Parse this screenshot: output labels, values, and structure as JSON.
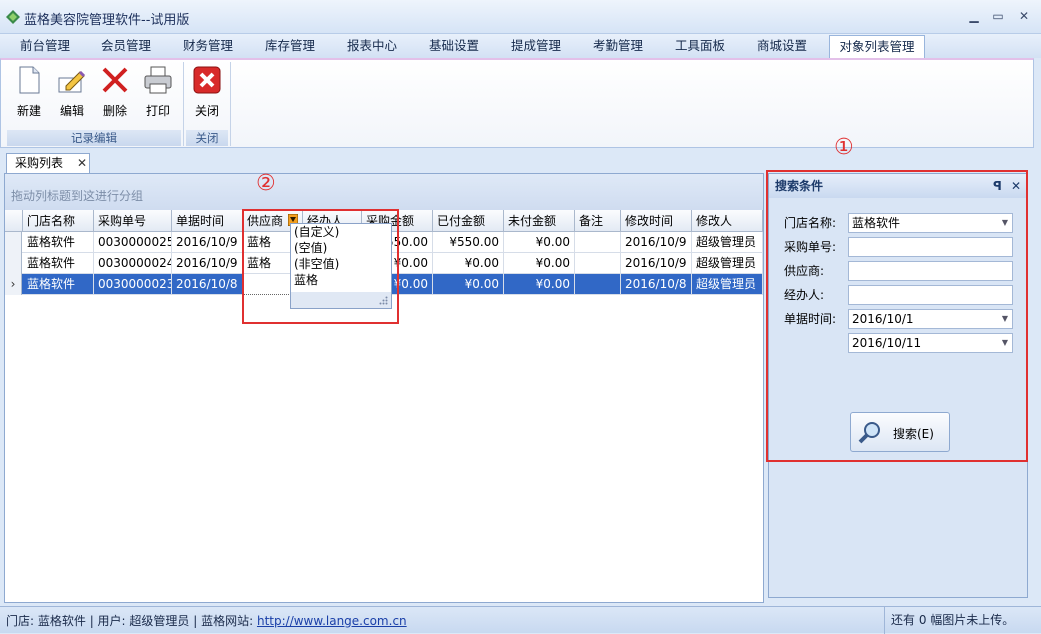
{
  "window": {
    "title": "蓝格美容院管理软件--试用版",
    "minimize": "▁",
    "maximize": "▭",
    "close": "✕"
  },
  "menu_tabs": [
    {
      "label": "前台管理"
    },
    {
      "label": "会员管理"
    },
    {
      "label": "财务管理"
    },
    {
      "label": "库存管理"
    },
    {
      "label": "报表中心"
    },
    {
      "label": "基础设置"
    },
    {
      "label": "提成管理"
    },
    {
      "label": "考勤管理"
    },
    {
      "label": "工具面板"
    },
    {
      "label": "商城设置"
    },
    {
      "label": "对象列表管理"
    }
  ],
  "ribbon": {
    "new": "新建",
    "edit": "编辑",
    "delete": "删除",
    "print": "打印",
    "close": "关闭",
    "group_record": "记录编辑",
    "group_close": "关闭"
  },
  "doc_tab": {
    "label": "采购列表",
    "close": "✕"
  },
  "grid": {
    "group_hint": "拖动列标题到这进行分组",
    "columns": [
      "门店名称",
      "采购单号",
      "单据时间",
      "供应商",
      "经办人",
      "采购金额",
      "已付金额",
      "未付金额",
      "备注",
      "修改时间",
      "修改人"
    ],
    "rows": [
      {
        "indicator": "",
        "store": "蓝格软件",
        "no": "0030000025",
        "date": "2016/10/9",
        "supplier": "蓝格",
        "handler": "",
        "amount": "¥550.00",
        "paid": "¥550.00",
        "unpaid": "¥0.00",
        "note": "",
        "mtime": "2016/10/9",
        "modifier": "超级管理员"
      },
      {
        "indicator": "",
        "store": "蓝格软件",
        "no": "0030000024",
        "date": "2016/10/9",
        "supplier": "蓝格",
        "handler": "",
        "amount": "¥0.00",
        "paid": "¥0.00",
        "unpaid": "¥0.00",
        "note": "",
        "mtime": "2016/10/9",
        "modifier": "超级管理员"
      },
      {
        "indicator": "›",
        "store": "蓝格软件",
        "no": "0030000023",
        "date": "2016/10/8",
        "supplier": "",
        "handler": "",
        "amount": "¥0.00",
        "paid": "¥0.00",
        "unpaid": "¥0.00",
        "note": "",
        "mtime": "2016/10/8",
        "modifier": "超级管理员"
      }
    ]
  },
  "filter_dropdown": {
    "options": [
      "(自定义)",
      "(空值)",
      "(非空值)",
      "蓝格"
    ]
  },
  "annotations": {
    "one": "①",
    "two": "②"
  },
  "search_panel": {
    "title": "搜索条件",
    "pin": "ꟼ",
    "close": "✕",
    "store_label": "门店名称:",
    "store_value": "蓝格软件",
    "no_label": "采购单号:",
    "no_value": "",
    "supplier_label": "供应商:",
    "supplier_value": "",
    "handler_label": "经办人:",
    "handler_value": "",
    "date_label": "单据时间:",
    "date_from": "2016/10/1",
    "date_to": "2016/10/11",
    "search_button": "搜索(E)"
  },
  "statusbar": {
    "store": "门店: 蓝格软件",
    "user": "| 用户: 超级管理员",
    "site_label": "| 蓝格网站:",
    "site_url": "http://www.lange.com.cn",
    "upload": "还有 0 幅图片未上传。"
  },
  "colors": {
    "selection": "#3168c6",
    "annotation": "#e03030"
  }
}
